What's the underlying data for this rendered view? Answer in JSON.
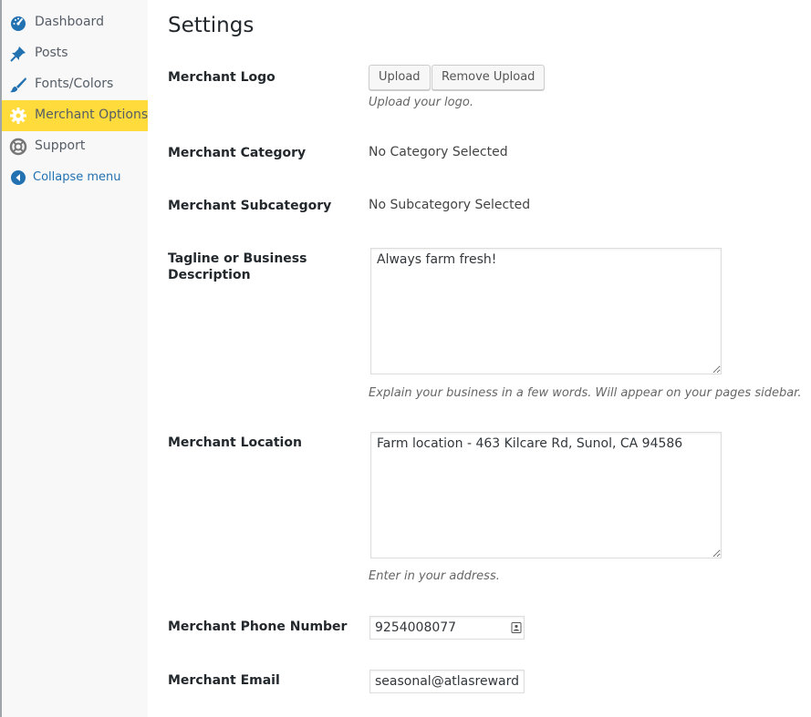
{
  "sidebar": {
    "items": [
      {
        "label": "Dashboard",
        "icon": "dashboard-icon"
      },
      {
        "label": "Posts",
        "icon": "pin-icon"
      },
      {
        "label": "Fonts/Colors",
        "icon": "brush-icon"
      },
      {
        "label": "Merchant Options",
        "icon": "gear-icon",
        "active": true
      },
      {
        "label": "Support",
        "icon": "lifebuoy-icon"
      }
    ],
    "collapse_label": "Collapse menu"
  },
  "page": {
    "title": "Settings"
  },
  "fields": {
    "logo": {
      "label": "Merchant Logo",
      "upload_button": "Upload",
      "remove_button": "Remove Upload",
      "description": "Upload your logo."
    },
    "category": {
      "label": "Merchant Category",
      "value": "No Category Selected"
    },
    "subcategory": {
      "label": "Merchant Subcategory",
      "value": "No Subcategory Selected"
    },
    "tagline": {
      "label": "Tagline or Business Description",
      "value": "Always farm fresh!",
      "description": "Explain your business in a few words. Will appear on your pages sidebar."
    },
    "location": {
      "label": "Merchant Location",
      "value": "Farm location - 463 Kilcare Rd, Sunol, CA 94586",
      "description": "Enter in your address."
    },
    "phone": {
      "label": "Merchant Phone Number",
      "value": "9254008077"
    },
    "email": {
      "label": "Merchant Email",
      "value": "seasonal@atlasrewards."
    }
  },
  "colors": {
    "accent": "#ffdb3c",
    "link": "#2271b1",
    "icon_blue": "#2271b1"
  }
}
